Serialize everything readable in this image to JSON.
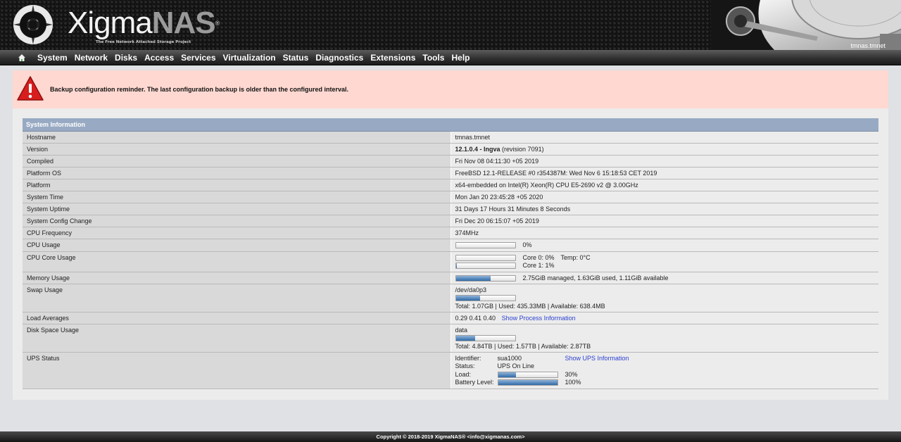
{
  "header": {
    "logo_main": "Xigma",
    "logo_accent": "NAS",
    "logo_registered": "®",
    "logo_tagline": "The Free Network Attached Storage Project",
    "hostname": "tmnas.tmnet"
  },
  "nav": {
    "home_icon": "home-icon",
    "items": [
      "System",
      "Network",
      "Disks",
      "Access",
      "Services",
      "Virtualization",
      "Status",
      "Diagnostics",
      "Extensions",
      "Tools",
      "Help"
    ]
  },
  "alert": {
    "icon": "warning-triangle-icon",
    "text": "Backup configuration reminder. The last configuration backup is older than the configured interval."
  },
  "sysinfo": {
    "title": "System Information",
    "hostname": {
      "label": "Hostname",
      "value": "tmnas.tmnet"
    },
    "version": {
      "label": "Version",
      "bold": "12.1.0.4 - Ingva",
      "rest": " (revision 7091)"
    },
    "compiled": {
      "label": "Compiled",
      "value": "Fri Nov 08 04:11:30 +05 2019"
    },
    "platform_os": {
      "label": "Platform OS",
      "value": "FreeBSD 12.1-RELEASE #0 r354387M: Wed Nov 6 15:18:53 CET 2019"
    },
    "platform": {
      "label": "Platform",
      "value": "x64-embedded on Intel(R) Xeon(R) CPU E5-2690 v2 @ 3.00GHz"
    },
    "system_time": {
      "label": "System Time",
      "value": "Mon Jan 20 23:45:28 +05 2020"
    },
    "uptime": {
      "label": "System Uptime",
      "value": "31 Days 17 Hours 31 Minutes 8 Seconds"
    },
    "config_change": {
      "label": "System Config Change",
      "value": "Fri Dec 20 06:15:07 +05 2019"
    },
    "cpu_freq": {
      "label": "CPU Frequency",
      "value": "374MHz"
    },
    "cpu_usage": {
      "label": "CPU Usage",
      "percent": 0,
      "text": "0%"
    },
    "cpu_core": {
      "label": "CPU Core Usage",
      "core0": {
        "percent": 0,
        "text": "Core 0: 0%",
        "temp": "Temp: 0°C"
      },
      "core1": {
        "percent": 1,
        "text": "Core 1: 1%"
      }
    },
    "memory": {
      "label": "Memory Usage",
      "percent": 59,
      "text": "2.75GiB managed, 1.63GiB used, 1.11GiB available"
    },
    "swap": {
      "label": "Swap Usage",
      "device": "/dev/da0p3",
      "percent": 41,
      "summary": "Total: 1.07GB | Used: 435.33MB | Available: 638.4MB"
    },
    "load": {
      "label": "Load Averages",
      "value": "0.29 0.41 0.40",
      "link": "Show Process Information"
    },
    "disk": {
      "label": "Disk Space Usage",
      "pool": "data",
      "percent": 33,
      "summary": "Total: 4.84TB | Used: 1.57TB | Available: 2.87TB"
    },
    "ups": {
      "label": "UPS Status",
      "identifier_label": "Identifier:",
      "identifier": "sua1000",
      "link": "Show UPS Information",
      "status_label": "Status:",
      "status": "UPS On Line",
      "load_label": "Load:",
      "load_percent": 30,
      "load_text": "30%",
      "battery_label": "Battery Level:",
      "battery_percent": 100,
      "battery_text": "100%"
    }
  },
  "footer": {
    "text": "Copyright © 2018-2019 XigmaNAS® <info@xigmanas.com>"
  }
}
